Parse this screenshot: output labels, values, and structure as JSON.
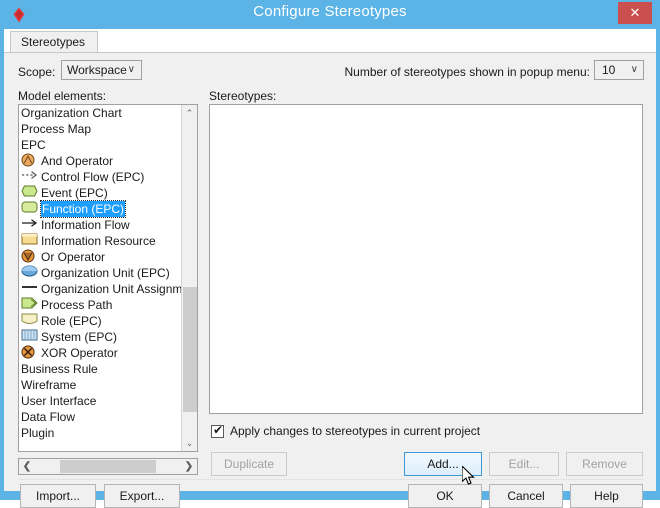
{
  "window": {
    "title": "Configure Stereotypes",
    "app_icon": "red-diamond-icon",
    "close_label": "✕",
    "frame_color": "#5cb4e6",
    "close_color": "#c9504f"
  },
  "tabs": [
    {
      "label": "Stereotypes",
      "selected": true
    }
  ],
  "scope": {
    "label": "Scope:",
    "value": "Workspace",
    "caret": "∨"
  },
  "popup_count": {
    "label": "Number of stereotypes shown in popup menu:",
    "value": "10",
    "caret": "∨"
  },
  "left_pane": {
    "label": "Model elements:",
    "items": [
      {
        "label": "Organization Chart",
        "icon": "none"
      },
      {
        "label": "Process Map",
        "icon": "none"
      },
      {
        "label": "EPC",
        "icon": "none"
      },
      {
        "label": "And Operator",
        "icon": "and-operator-icon"
      },
      {
        "label": "Control Flow (EPC)",
        "icon": "control-flow-icon"
      },
      {
        "label": "Event (EPC)",
        "icon": "event-icon"
      },
      {
        "label": "Function (EPC)",
        "icon": "function-icon",
        "selected": true
      },
      {
        "label": "Information Flow",
        "icon": "information-flow-icon"
      },
      {
        "label": "Information Resource",
        "icon": "information-resource-icon"
      },
      {
        "label": "Or Operator",
        "icon": "or-operator-icon"
      },
      {
        "label": "Organization Unit (EPC)",
        "icon": "organization-unit-icon"
      },
      {
        "label": "Organization Unit Assignment",
        "icon": "assignment-line-icon"
      },
      {
        "label": "Process Path",
        "icon": "process-path-icon"
      },
      {
        "label": "Role (EPC)",
        "icon": "role-icon"
      },
      {
        "label": "System (EPC)",
        "icon": "system-icon"
      },
      {
        "label": "XOR Operator",
        "icon": "xor-operator-icon"
      },
      {
        "label": "Business Rule",
        "icon": "none"
      },
      {
        "label": "Wireframe",
        "icon": "none"
      },
      {
        "label": "User Interface",
        "icon": "none"
      },
      {
        "label": "Data Flow",
        "icon": "none"
      },
      {
        "label": "Plugin",
        "icon": "none"
      }
    ],
    "scroll_up": "⌃",
    "scroll_down": "⌄",
    "scroll_left": "❮",
    "scroll_right": "❯"
  },
  "right_pane": {
    "label": "Stereotypes:",
    "items": []
  },
  "apply_option": {
    "label": "Apply changes to stereotypes in current project",
    "checked": true,
    "check_glyph": "✔"
  },
  "item_buttons": {
    "duplicate": "Duplicate",
    "add": "Add...",
    "edit": "Edit...",
    "remove": "Remove"
  },
  "bottom_buttons": {
    "import": "Import...",
    "export": "Export...",
    "ok": "OK",
    "cancel": "Cancel",
    "help": "Help"
  },
  "colors": {
    "selection": "#1e9fff",
    "hover_border": "#3c99d4",
    "dialog_bg": "#f0f0f0"
  }
}
